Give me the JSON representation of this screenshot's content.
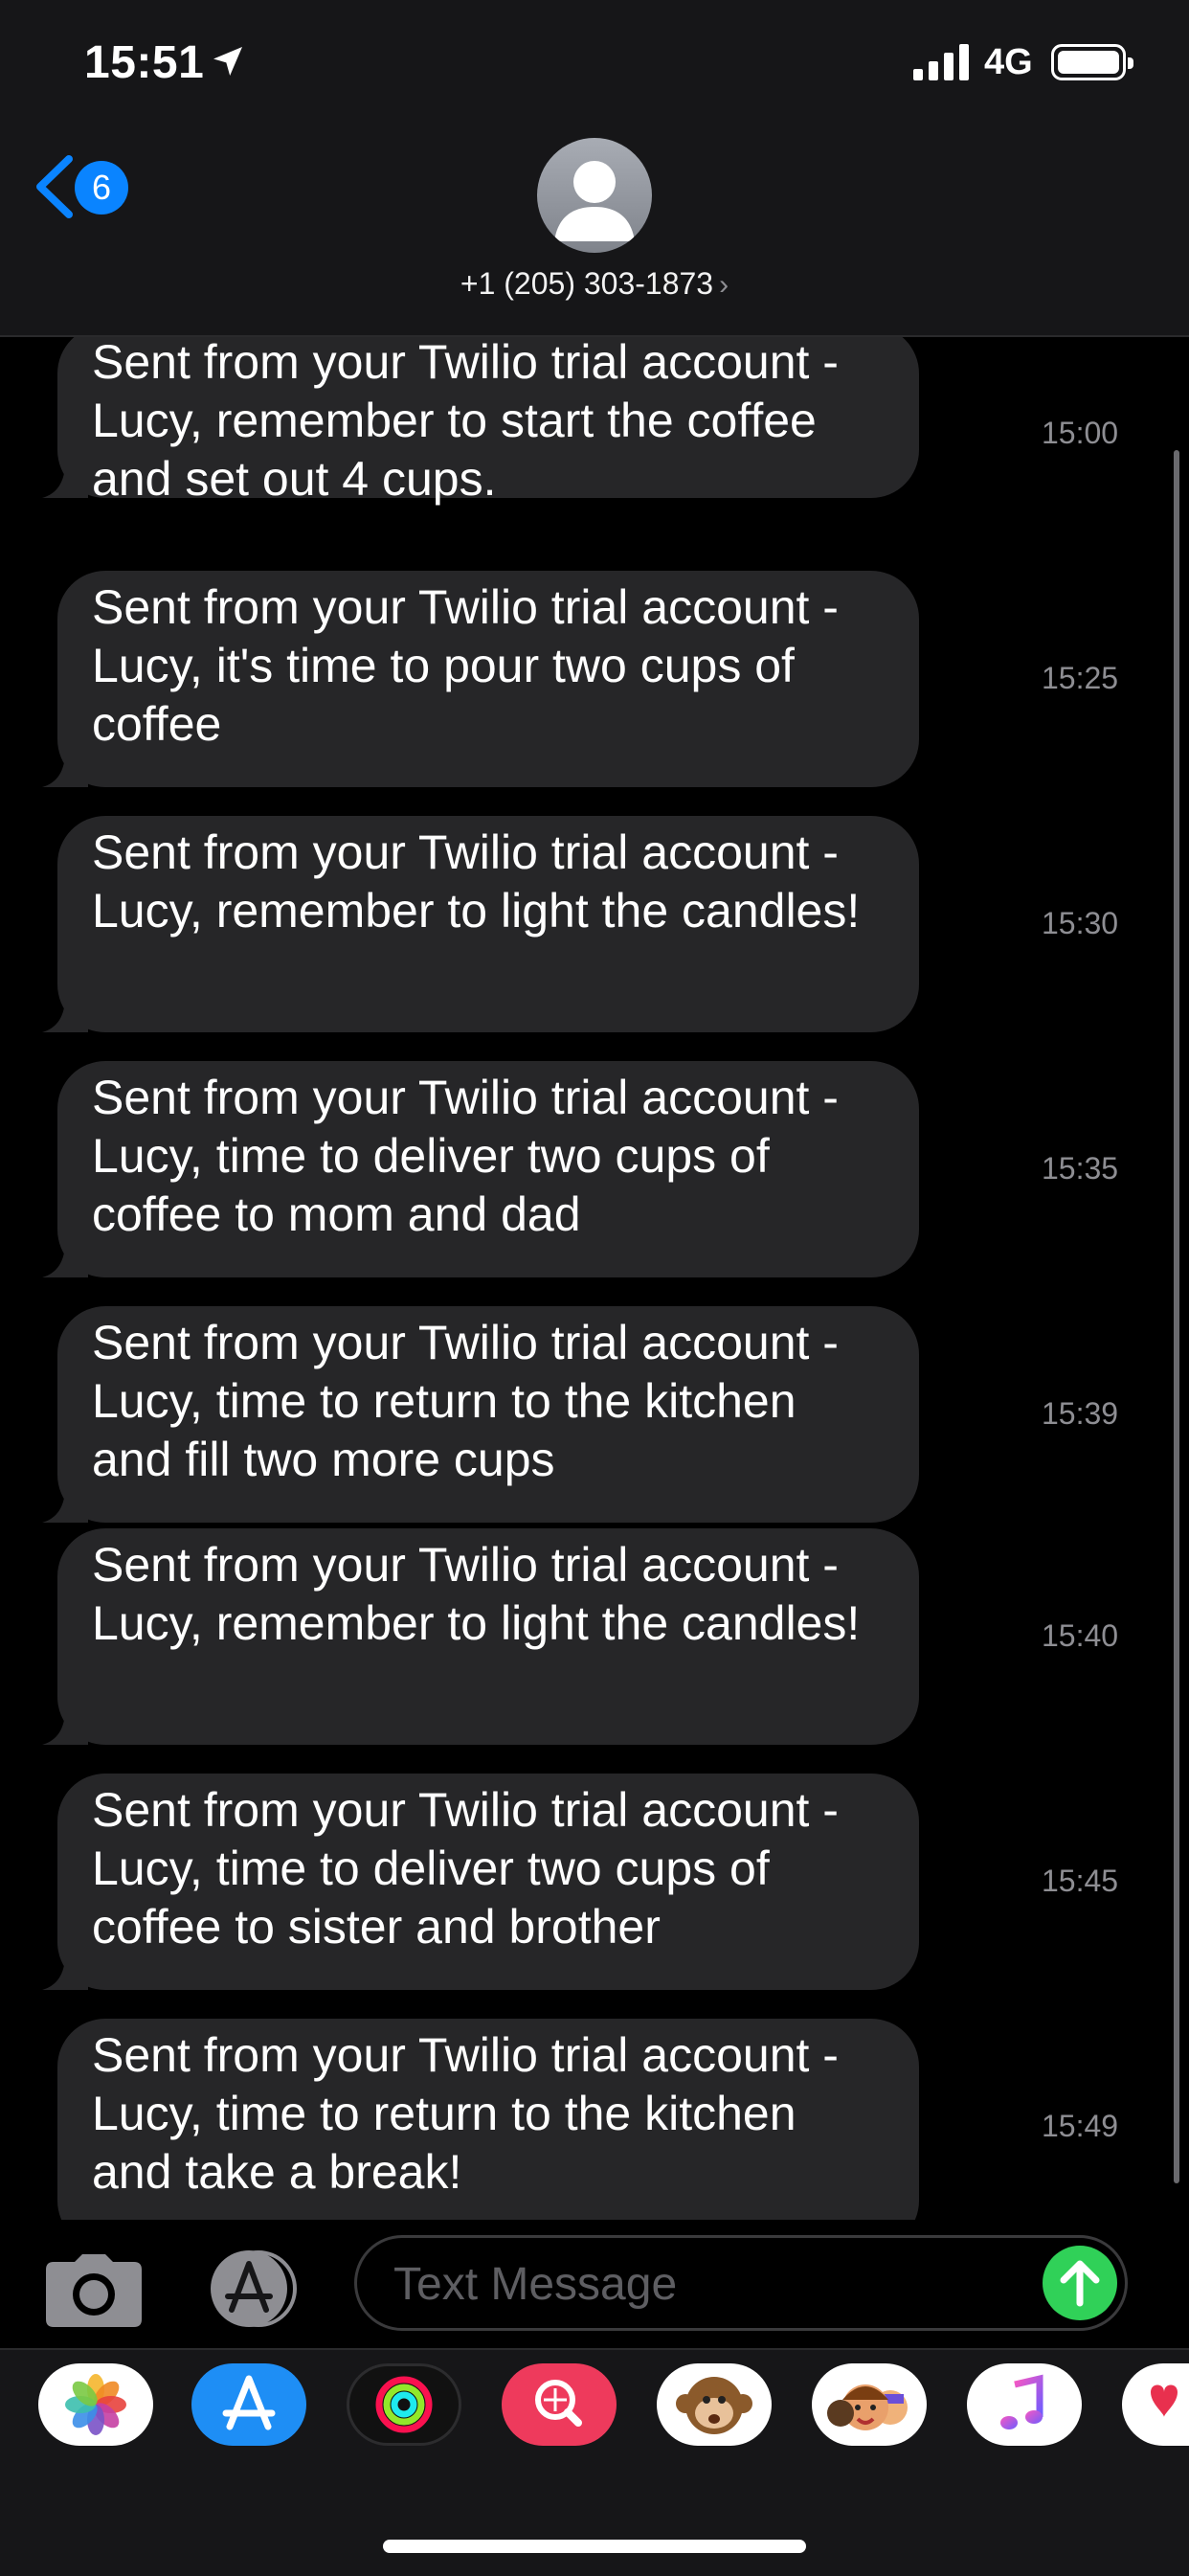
{
  "status_bar": {
    "time": "15:51",
    "network": "4G"
  },
  "header": {
    "back_badge": "6",
    "contact": "+1 (205) 303-1873"
  },
  "messages": [
    {
      "text": "Sent from your Twilio trial account - Lucy, remember to start the coffee and set out 4 cups.",
      "time": "15:00"
    },
    {
      "text": "Sent from your Twilio trial account - Lucy, it's time to pour two cups of coffee",
      "time": "15:25"
    },
    {
      "text": "Sent from your Twilio trial account - Lucy, remember to light the candles!",
      "time": "15:30"
    },
    {
      "text": "Sent from your Twilio trial account - Lucy, time to deliver two cups of coffee to mom and dad",
      "time": "15:35"
    },
    {
      "text": "Sent from your Twilio trial account - Lucy, time to return to the kitchen and fill two more cups",
      "time": "15:39"
    },
    {
      "text": "Sent from your Twilio trial account - Lucy, remember to light the candles!",
      "time": "15:40"
    },
    {
      "text": "Sent from your Twilio trial account - Lucy, time to deliver two cups of coffee to sister and brother",
      "time": "15:45"
    },
    {
      "text": "Sent from your Twilio trial account - Lucy, time to return to the kitchen and take a break!",
      "time": "15:49"
    }
  ],
  "input": {
    "placeholder": "Text Message"
  },
  "drawer_apps": [
    "photos-app-icon",
    "app-store-icon",
    "activity-rings-icon",
    "web-image-search-icon",
    "animoji-monkey-icon",
    "memoji-icon",
    "music-icon",
    "digital-touch-icon"
  ],
  "colors": {
    "accent": "#0a84ff",
    "bubble": "#262628",
    "send": "#30d158"
  }
}
